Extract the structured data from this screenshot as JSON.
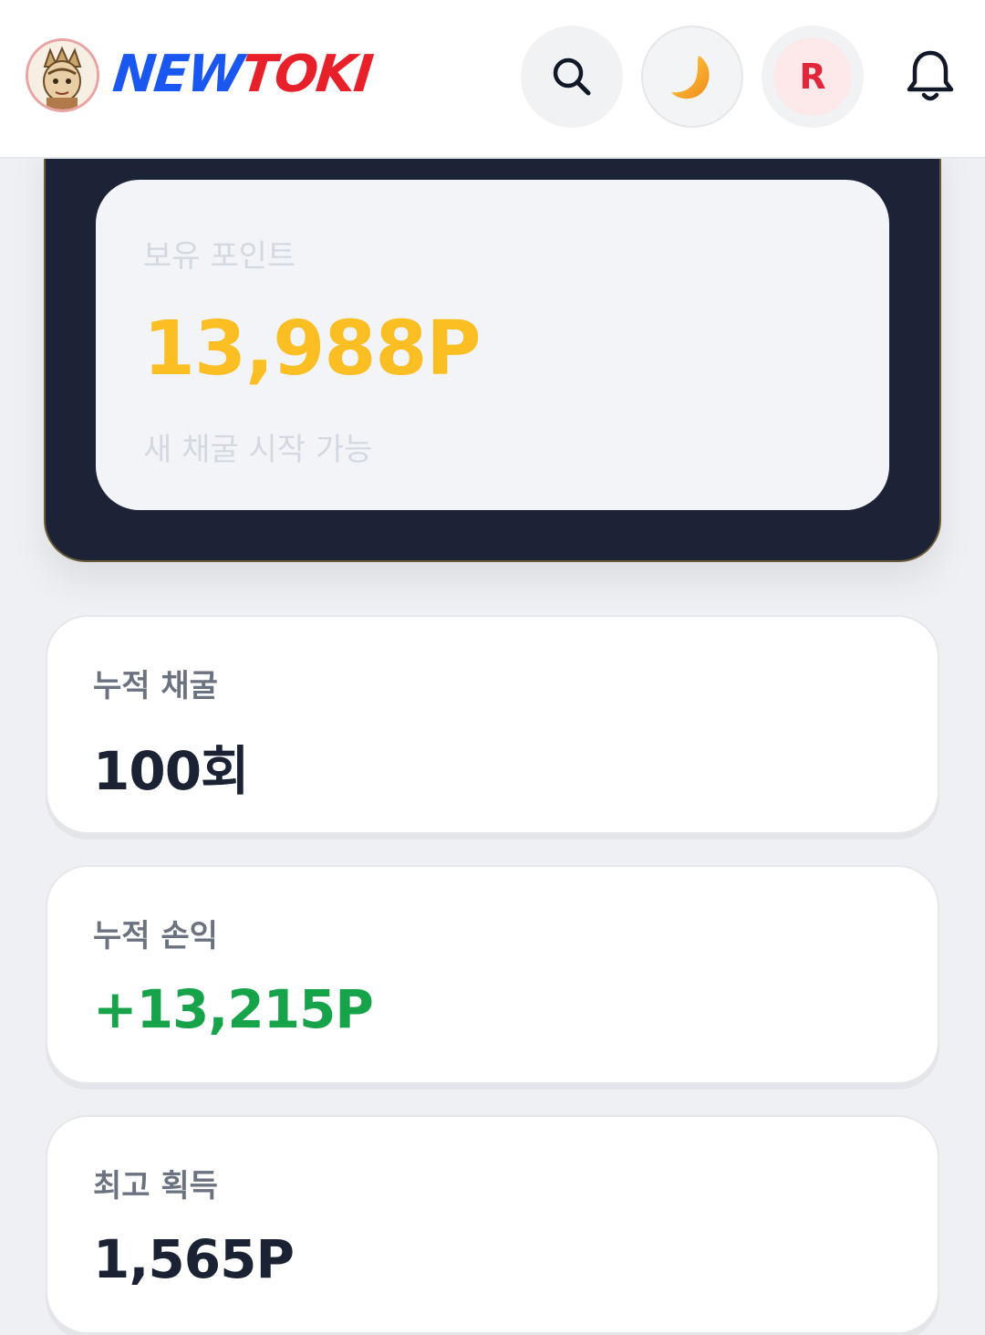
{
  "header": {
    "logo_part1": "NEW",
    "logo_part2": "TOKI",
    "profile_initial": "R"
  },
  "points": {
    "label": "보유 포인트",
    "value": "13,988P",
    "subtext": "새 채굴 시작 가능"
  },
  "stats": [
    {
      "label": "누적 채굴",
      "value": "100회"
    },
    {
      "label": "누적 손익",
      "value": "+13,215P"
    },
    {
      "label": "최고 획득",
      "value": "1,565P"
    }
  ],
  "colors": {
    "brand_blue": "#1a57f0",
    "brand_red": "#e8202a",
    "points_gold": "#fbbf24",
    "profit_green": "#16a34a",
    "dark_card": "#1d2336"
  },
  "icons": [
    "search-icon",
    "moon-icon",
    "bell-icon",
    "mascot-avatar"
  ]
}
